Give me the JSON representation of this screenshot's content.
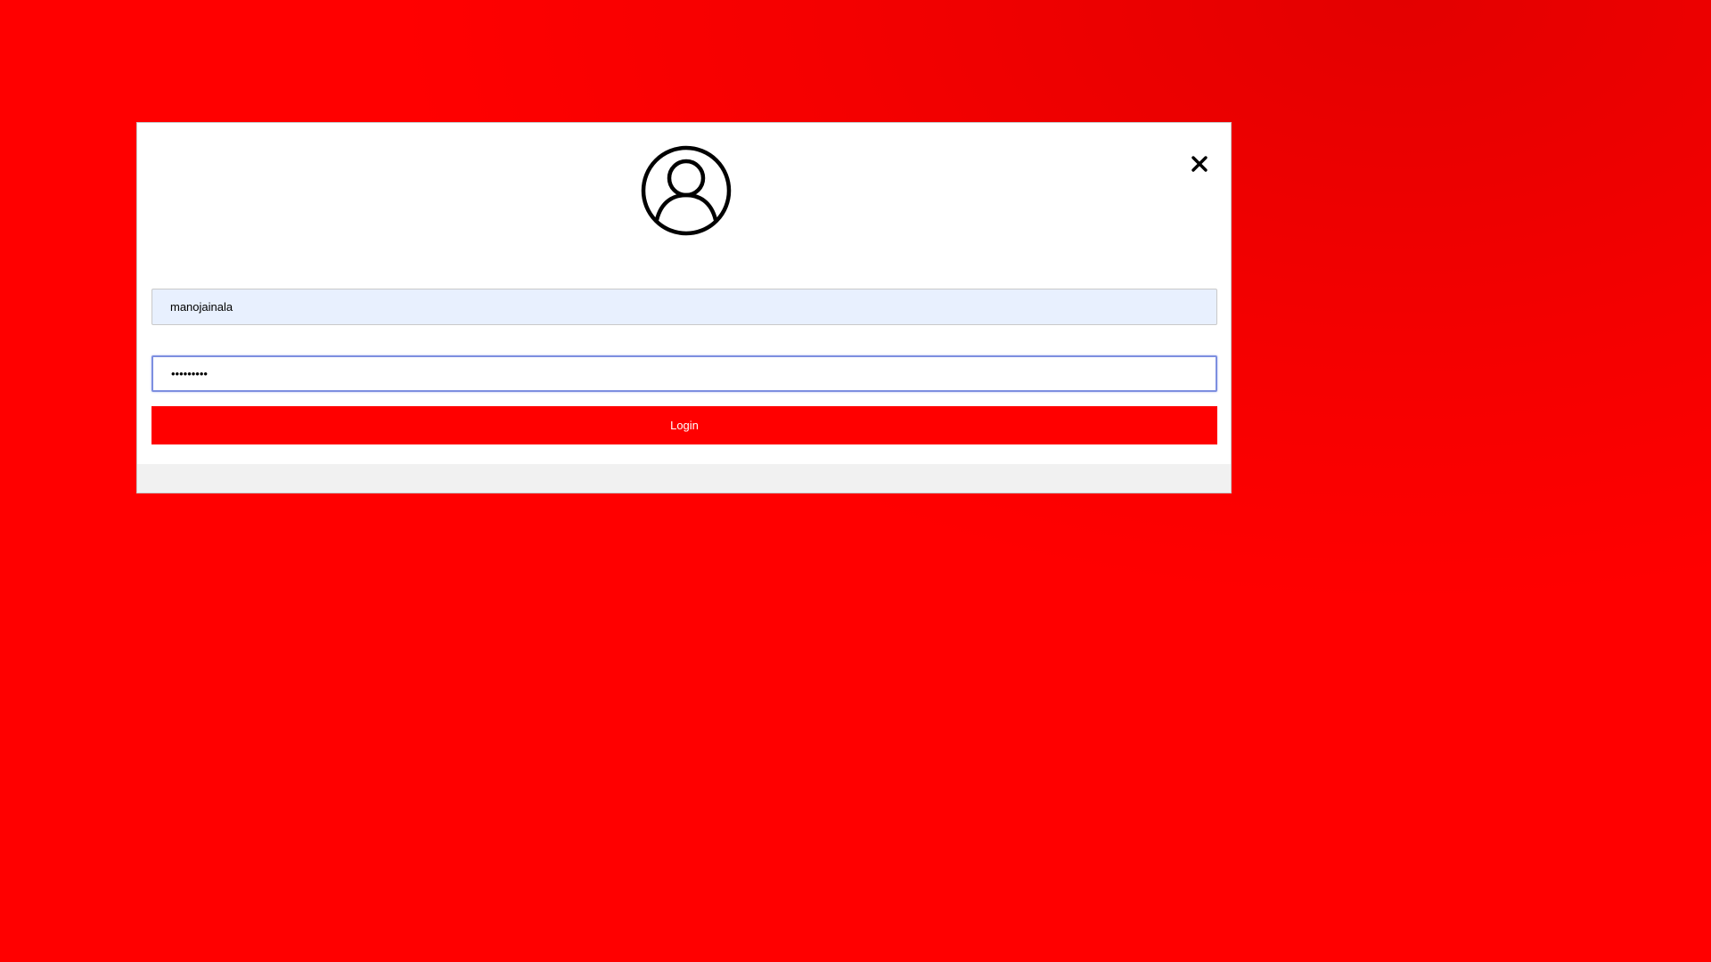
{
  "login_form": {
    "avatar_icon": "user-circle-icon",
    "close_icon": "close-icon",
    "username_value": "manojainala",
    "password_value": "•••••••••",
    "login_label": "Login"
  },
  "colors": {
    "background": "#ff0000",
    "button": "#ff0000",
    "button_text": "#ffffff",
    "username_bg": "#e8f0fe",
    "focus_border": "#7d8fe0",
    "footer_bg": "#f1f1f1"
  }
}
